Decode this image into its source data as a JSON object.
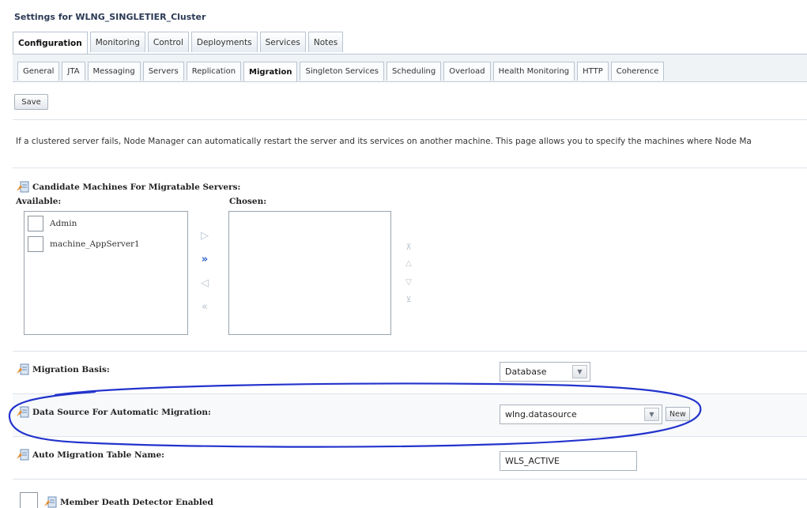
{
  "page": {
    "title": "Settings for WLNG_SINGLETIER_Cluster"
  },
  "main_tabs": [
    {
      "label": "Configuration",
      "active": true
    },
    {
      "label": "Monitoring",
      "active": false
    },
    {
      "label": "Control",
      "active": false
    },
    {
      "label": "Deployments",
      "active": false
    },
    {
      "label": "Services",
      "active": false
    },
    {
      "label": "Notes",
      "active": false
    }
  ],
  "sub_tabs": [
    {
      "label": "General",
      "active": false
    },
    {
      "label": "JTA",
      "active": false
    },
    {
      "label": "Messaging",
      "active": false
    },
    {
      "label": "Servers",
      "active": false
    },
    {
      "label": "Replication",
      "active": false
    },
    {
      "label": "Migration",
      "active": true
    },
    {
      "label": "Singleton Services",
      "active": false
    },
    {
      "label": "Scheduling",
      "active": false
    },
    {
      "label": "Overload",
      "active": false
    },
    {
      "label": "Health Monitoring",
      "active": false
    },
    {
      "label": "HTTP",
      "active": false
    },
    {
      "label": "Coherence",
      "active": false
    }
  ],
  "toolbar": {
    "save_label": "Save"
  },
  "intro_text": "If a clustered server fails, Node Manager can automatically restart the server and its services on another machine. This page allows you to specify the machines where Node Ma",
  "candidate_machines": {
    "label": "Candidate Machines For Migratable Servers:",
    "available_label": "Available:",
    "chosen_label": "Chosen:",
    "available_items": [
      "Admin",
      "machine_AppServer1"
    ],
    "chosen_items": []
  },
  "migration_basis": {
    "label": "Migration Basis:",
    "value": "Database"
  },
  "data_source": {
    "label": "Data Source For Automatic Migration:",
    "value": "wlng.datasource",
    "new_label": "New"
  },
  "auto_migration_table": {
    "label": "Auto Migration Table Name:",
    "value": "WLS_ACTIVE"
  },
  "member_death_detector": {
    "label": "Member Death Detector Enabled",
    "checked": false
  },
  "colors": {
    "annotation_stroke": "#2233cc",
    "accent": "#2b3a55"
  }
}
